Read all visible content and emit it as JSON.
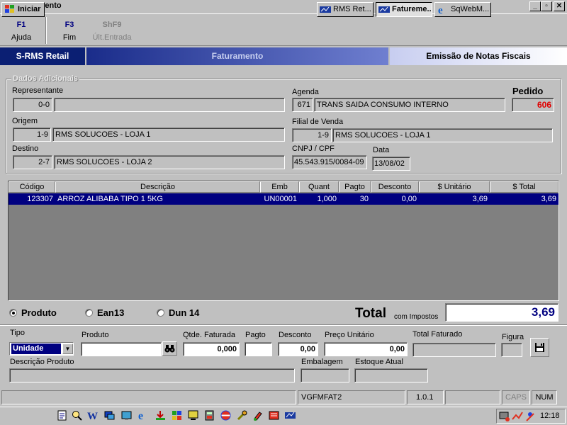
{
  "window": {
    "title": "Faturamento",
    "minimize": "_",
    "restore": "▫",
    "close": "✕"
  },
  "toolbar": [
    {
      "key": "F1",
      "label": "Ajuda"
    },
    {
      "key": "F3",
      "label": "Fim"
    },
    {
      "key": "ShF9",
      "label": "Últ.Entrada"
    }
  ],
  "banner": {
    "brand": "S-RMS Retail",
    "module": "Faturamento",
    "screen": "Emissão de Notas Fiscais"
  },
  "dados": {
    "group_label": "Dados Adicionais",
    "representante": {
      "label": "Representante",
      "code": "0-0",
      "name": ""
    },
    "agenda": {
      "label": "Agenda",
      "code": "671",
      "name": "TRANS SAIDA CONSUMO INTERNO"
    },
    "pedido": {
      "label": "Pedido",
      "value": "606"
    },
    "origem": {
      "label": "Origem",
      "code": "1-9",
      "name": "RMS SOLUCOES - LOJA 1"
    },
    "filial": {
      "label": "Filial de Venda",
      "code": "1-9",
      "name": "RMS SOLUCOES - LOJA 1"
    },
    "destino": {
      "label": "Destino",
      "code": "2-7",
      "name": "RMS SOLUCOES - LOJA 2"
    },
    "cnpj": {
      "label": "CNPJ / CPF",
      "value": "45.543.915/0084-09"
    },
    "data": {
      "label": "Data",
      "value": "13/08/02"
    }
  },
  "grid": {
    "columns": [
      "Código",
      "Descrição",
      "Emb",
      "Quant",
      "Pagto",
      "Desconto",
      "$ Unitário",
      "$ Total"
    ],
    "rows": [
      [
        "123307",
        "ARROZ ALIBABA TIPO 1 5KG",
        "UN00001",
        "1,000",
        "30",
        "0,00",
        "3,69",
        "3,69"
      ]
    ]
  },
  "search_mode": {
    "options": [
      "Produto",
      "Ean13",
      "Dun 14"
    ],
    "selected": "Produto"
  },
  "total": {
    "label": "Total",
    "sub": "com Impostos",
    "value": "3,69"
  },
  "entry": {
    "tipo": {
      "label": "Tipo",
      "value": "Unidade"
    },
    "produto": {
      "label": "Produto",
      "value": ""
    },
    "qtde": {
      "label": "Qtde. Faturada",
      "value": "0,000"
    },
    "pagto": {
      "label": "Pagto",
      "value": ""
    },
    "desconto": {
      "label": "Desconto",
      "value": "0,00"
    },
    "preco": {
      "label": "Preço Unitário",
      "value": "0,00"
    },
    "total_faturado": {
      "label": "Total Faturado",
      "value": ""
    },
    "figura": {
      "label": "Figura",
      "value": ""
    },
    "descricao": {
      "label": "Descrição Produto",
      "value": ""
    },
    "embalagem": {
      "label": "Embalagem",
      "value": ""
    },
    "estoque": {
      "label": "Estoque Atual",
      "value": ""
    }
  },
  "statusbar": {
    "form": "VGFMFAT2",
    "version": "1.0.1",
    "caps": "CAPS",
    "num": "NUM"
  },
  "taskbar": {
    "start": "Iniciar",
    "tasks": [
      "RMS Ret...",
      "Fatureme...",
      "SqWebM..."
    ],
    "clock": "12:18"
  },
  "colors": {
    "selection": "#000080",
    "pedido": "#e00000",
    "total_value": "#000080",
    "banner_dark": "#0b1f73"
  }
}
